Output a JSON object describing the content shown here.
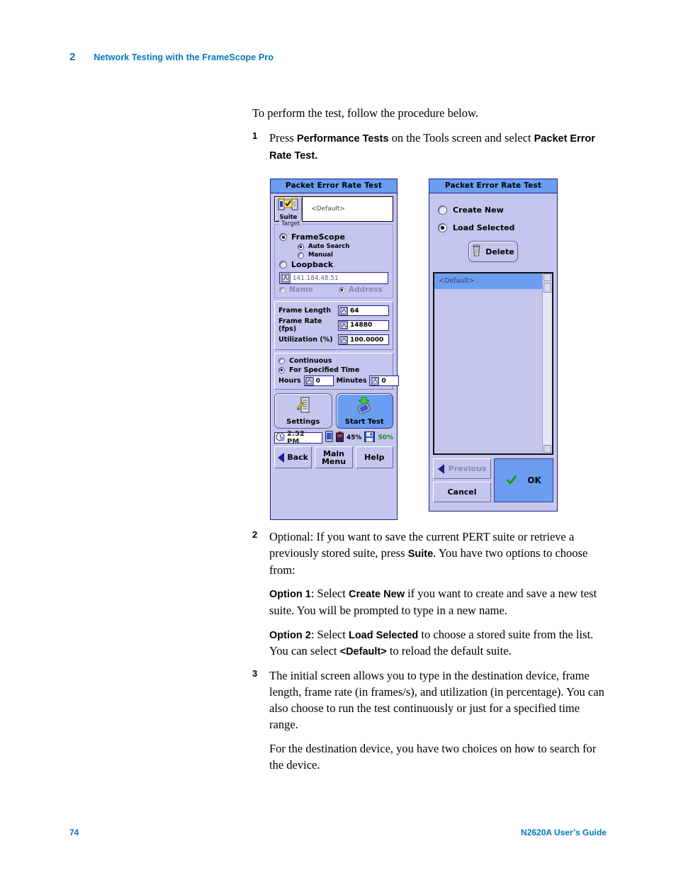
{
  "header": {
    "chapter_number": "2",
    "chapter_title": "Network Testing with the FrameScope Pro"
  },
  "footer": {
    "page_number": "74",
    "guide_title": "N2620A User’s Guide"
  },
  "body": {
    "intro": "To perform the test, follow the procedure below.",
    "step1": {
      "num": "1",
      "t1": "Press ",
      "b1": "Performance Tests",
      "t2": " on the Tools screen and select ",
      "b2": "Packet Error Rate Test."
    },
    "step2": {
      "num": "2",
      "t1": "Optional: If you want to save the current PERT suite or retrieve a previously stored suite, press ",
      "b1": "Suite",
      "t2": ". You have two options to choose from:"
    },
    "option1": {
      "b1": "Option 1",
      "t1": ": Select ",
      "b2": "Create New",
      "t2": " if you want to create and save a new test suite. You will be prompted to type in a new name."
    },
    "option2": {
      "b1": "Option 2",
      "t1": ": Select ",
      "b2": "Load Selected",
      "t2": " to choose a stored suite from the list. You can select ",
      "b3": "<Default>",
      "t3": " to reload the default suite."
    },
    "step3": {
      "num": "3",
      "t1": "The initial screen allows you to type in the destination device, frame length, frame rate (in frames/s), and utilization (in percentage). You can also choose to run the test continuously or just for a specified time range."
    },
    "step3b": {
      "t1": "For the destination device, you have two choices on how to search for the device."
    }
  },
  "left_screen": {
    "title": "Packet Error Rate Test",
    "suite_button_label": "Suite",
    "suite_value": "<Default>",
    "target_group_label": "Target",
    "radio_framescope": "FrameScope",
    "radio_auto_search": "Auto Search",
    "radio_manual": "Manual",
    "radio_loopback": "Loopback",
    "address_value": "141.184.48.51",
    "radio_name": "Name",
    "radio_address": "Address",
    "params": [
      {
        "label": "Frame Length",
        "value": "64"
      },
      {
        "label": "Frame Rate (fps)",
        "value": "14880"
      },
      {
        "label": "Utilization (%)",
        "value": "100.0000"
      }
    ],
    "radio_continuous": "Continuous",
    "radio_specified_time": "For Specified Time",
    "hours_label": "Hours",
    "hours_value": "0",
    "minutes_label": "Minutes",
    "minutes_value": "0",
    "settings_button": "Settings",
    "start_test_button": "Start Test",
    "status": {
      "time": "2:52 PM",
      "battery_pct": "45%",
      "memory_pct": "50%"
    },
    "nav": {
      "back": "Back",
      "main_menu_line1": "Main",
      "main_menu_line2": "Menu",
      "help": "Help"
    }
  },
  "right_screen": {
    "title": "Packet Error Rate Test",
    "radio_create_new": "Create New",
    "radio_load_selected": "Load Selected",
    "delete_button": "Delete",
    "list_items": [
      "<Default>"
    ],
    "nav": {
      "previous": "Previous",
      "cancel": "Cancel",
      "ok": "OK"
    }
  },
  "colors": {
    "accent_blue": "#0076c0",
    "titlebar_blue": "#6b9ef0",
    "panel_lavender": "#c5c6ee",
    "panel_border": "#20208c",
    "disabled_text": "#8b8bb8",
    "check_green": "#1a8a1a"
  }
}
